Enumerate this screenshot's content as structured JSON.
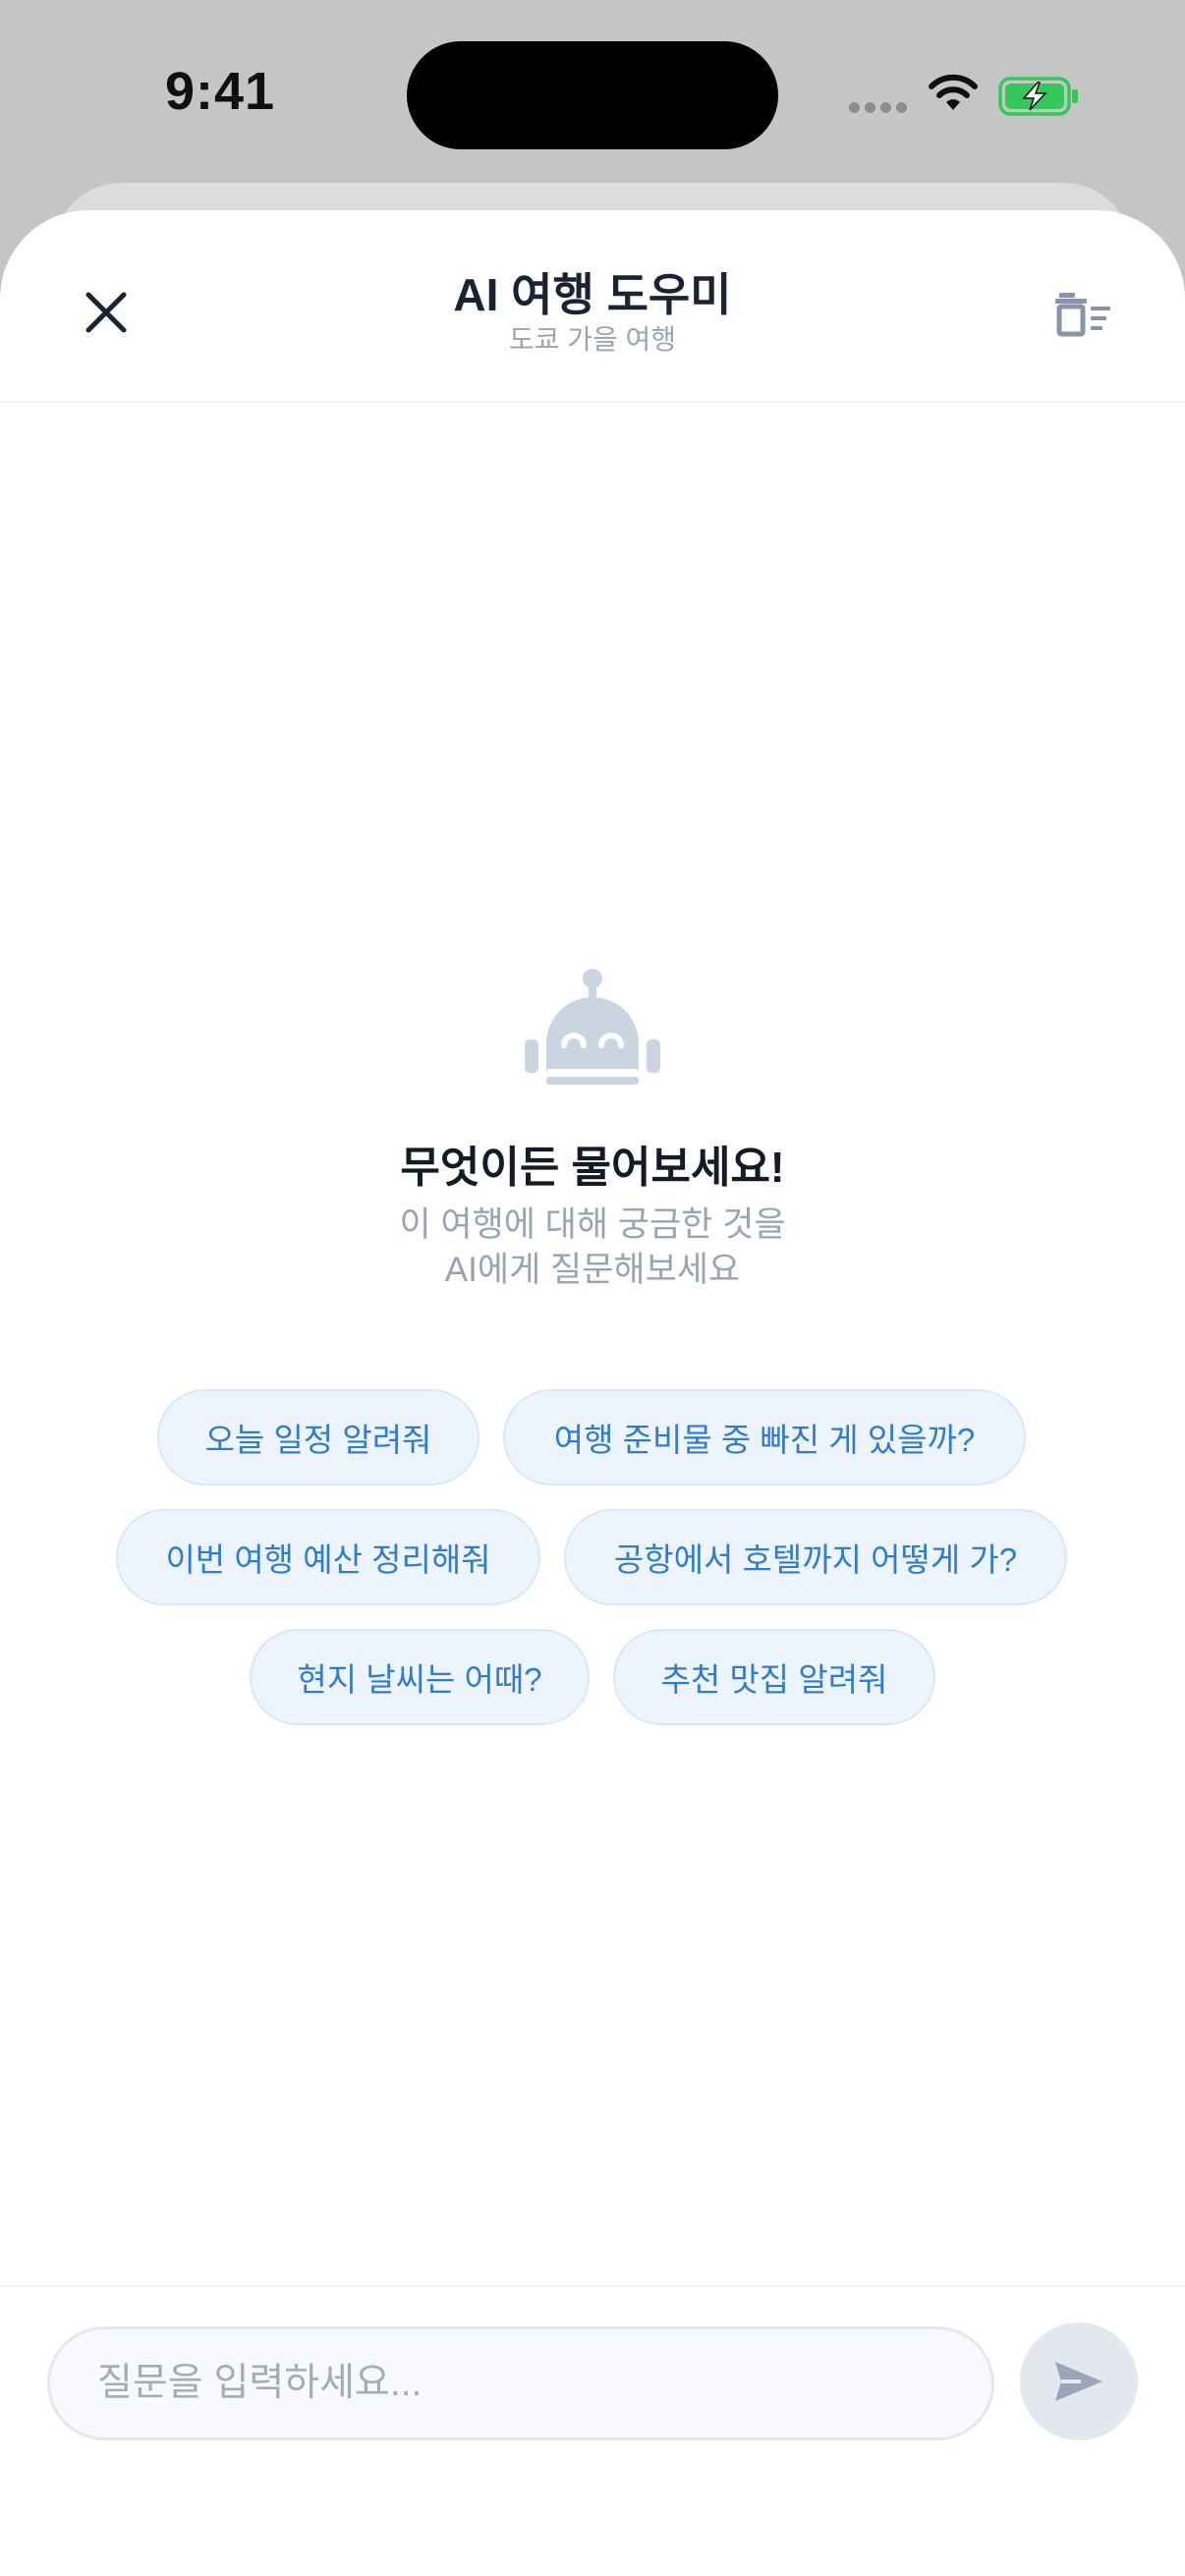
{
  "status_bar": {
    "time": "9:41",
    "battery_color": "#34c759",
    "icons": [
      "signal-dots-icon",
      "wifi-icon",
      "battery-charging-icon"
    ]
  },
  "header": {
    "title": "AI 여행 도우미",
    "subtitle": "도쿄 가을 여행",
    "close_icon": "close-icon",
    "clear_icon": "trash-list-icon"
  },
  "empty_state": {
    "icon": "robot-icon",
    "title": "무엇이든 물어보세요!",
    "desc_line1": "이 여행에 대해 궁금한 것을",
    "desc_line2": "AI에게 질문해보세요"
  },
  "suggestions": [
    "오늘 일정 알려줘",
    "여행 준비물 중 빠진 게 있을까?",
    "이번 여행 예산 정리해줘",
    "공항에서 호텔까지 어떻게 가?",
    "현지 날씨는 어때?",
    "추천 맛집 알려줘"
  ],
  "composer": {
    "placeholder": "질문을 입력하세요...",
    "value": "",
    "send_icon": "send-icon"
  },
  "colors": {
    "accent": "#2e7bd6",
    "chip_bg": "#edf4fd",
    "muted_text": "#9aa3b2",
    "title_text": "#1a2233"
  }
}
